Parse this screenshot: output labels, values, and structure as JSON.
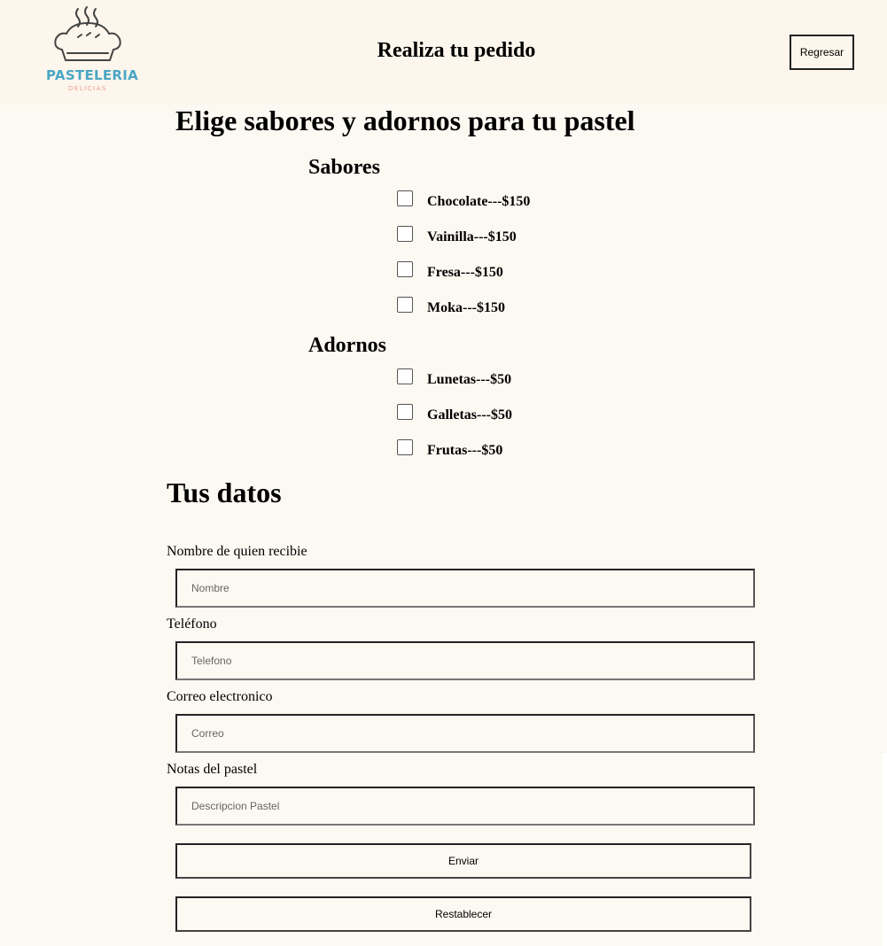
{
  "header": {
    "logo": {
      "word": "PASTELERIA",
      "sub": "DELICIAS",
      "icon": "pie-steam-icon"
    },
    "title": "Realiza tu pedido",
    "back_label": "Regresar"
  },
  "order": {
    "title": "Elige sabores y adornos para tu pastel",
    "flavors_title": "Sabores",
    "flavors": [
      {
        "label": "Chocolate---$150",
        "checked": false
      },
      {
        "label": "Vainilla---$150",
        "checked": false
      },
      {
        "label": "Fresa---$150",
        "checked": false
      },
      {
        "label": "Moka---$150",
        "checked": false
      }
    ],
    "toppings_title": "Adornos",
    "toppings": [
      {
        "label": "Lunetas---$50",
        "checked": false
      },
      {
        "label": "Galletas---$50",
        "checked": false
      },
      {
        "label": "Frutas---$50",
        "checked": false
      }
    ]
  },
  "form": {
    "title": "Tus datos",
    "fields": [
      {
        "label": "Nombre de quien recibie",
        "placeholder": "Nombre",
        "value": ""
      },
      {
        "label": "Teléfono",
        "placeholder": "Telefono",
        "value": ""
      },
      {
        "label": "Correo electronico",
        "placeholder": "Correo",
        "value": ""
      },
      {
        "label": "Notas del pastel",
        "placeholder": "Descripcion Pastel",
        "value": ""
      }
    ],
    "submit_label": "Enviar",
    "reset_label": "Restablecer"
  },
  "colors": {
    "page_bg": "#fcf8f2",
    "header_bg": "#fdf6ec",
    "logo_primary": "#4aa6c4",
    "logo_secondary": "#e99b8c"
  }
}
